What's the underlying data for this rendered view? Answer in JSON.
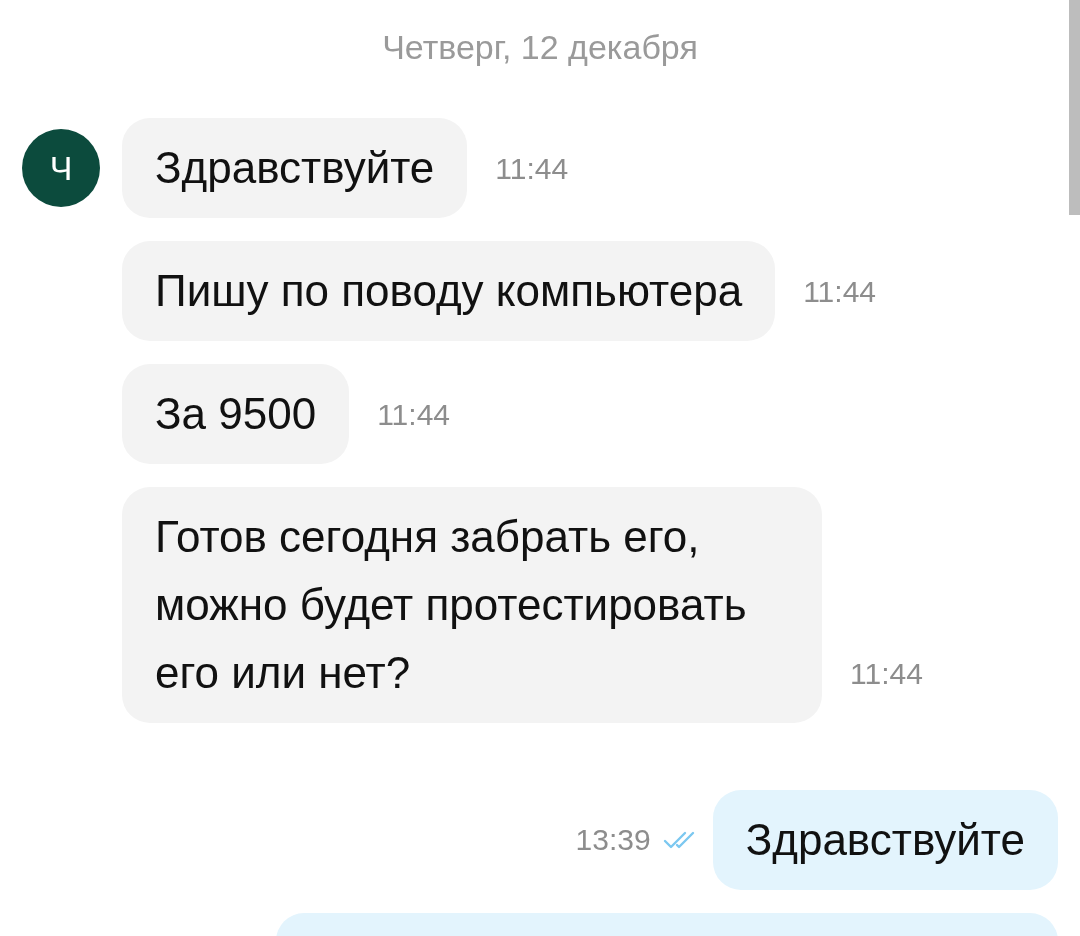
{
  "date_header": "Четверг, 12 декабря",
  "messages": [
    {
      "kind": "incoming",
      "avatar": "Ч",
      "text": "Здравствуйте",
      "time": "11:44"
    },
    {
      "kind": "incoming",
      "text": "Пишу по поводу компьютера",
      "time": "11:44"
    },
    {
      "kind": "incoming",
      "text": "За 9500",
      "time": "11:44"
    },
    {
      "kind": "incoming",
      "text": "Готов сегодня забрать его, можно будет протестировать его или нет?",
      "time": "11:44"
    },
    {
      "kind": "outgoing",
      "text": "Здравствуйте",
      "time": "13:39",
      "read": true
    },
    {
      "kind": "outgoing"
    }
  ]
}
